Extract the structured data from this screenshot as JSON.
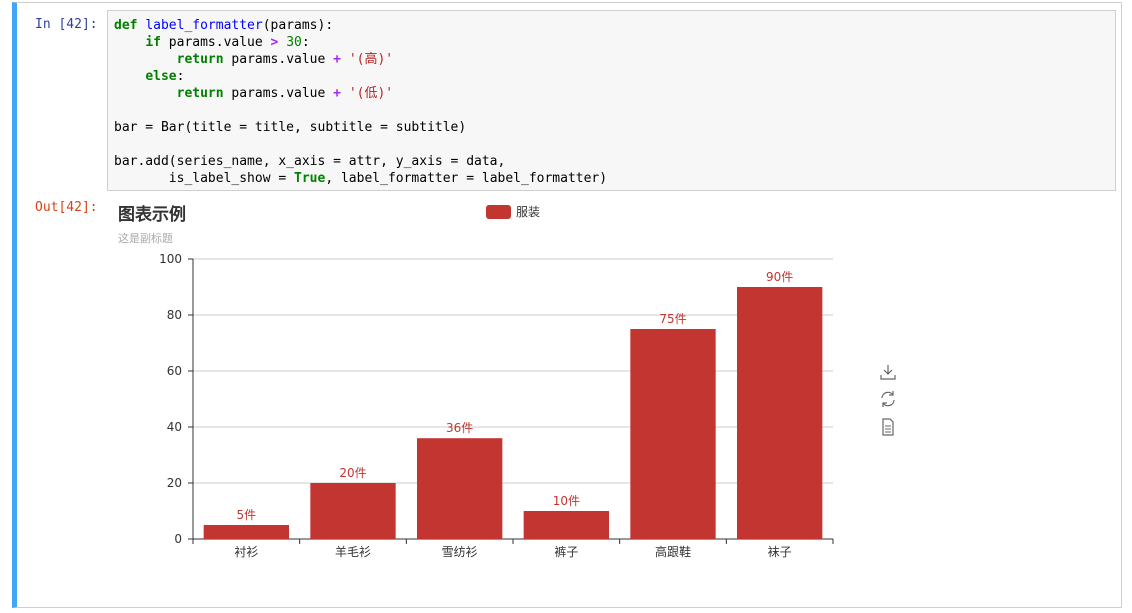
{
  "cell": {
    "in_prompt": "In [42]:",
    "out_prompt": "Out[42]:",
    "code_lines": [
      [
        [
          "kw",
          "def"
        ],
        [
          "t",
          " "
        ],
        [
          "fn",
          "label_formatter"
        ],
        [
          "t",
          "(params):"
        ]
      ],
      [
        [
          "t",
          "    "
        ],
        [
          "kw",
          "if"
        ],
        [
          "t",
          " params.value "
        ],
        [
          "op",
          ">"
        ],
        [
          "t",
          " "
        ],
        [
          "num",
          "30"
        ],
        [
          "t",
          ":"
        ]
      ],
      [
        [
          "t",
          "        "
        ],
        [
          "kw",
          "return"
        ],
        [
          "t",
          " params.value "
        ],
        [
          "op",
          "+"
        ],
        [
          "t",
          " "
        ],
        [
          "str",
          "'(高)'"
        ]
      ],
      [
        [
          "t",
          "    "
        ],
        [
          "kw",
          "else"
        ],
        [
          "t",
          ":"
        ]
      ],
      [
        [
          "t",
          "        "
        ],
        [
          "kw",
          "return"
        ],
        [
          "t",
          " params.value "
        ],
        [
          "op",
          "+"
        ],
        [
          "t",
          " "
        ],
        [
          "str",
          "'(低)'"
        ]
      ],
      [
        [
          "t",
          ""
        ]
      ],
      [
        [
          "t",
          "bar = Bar(title = title, subtitle = subtitle)"
        ]
      ],
      [
        [
          "t",
          ""
        ]
      ],
      [
        [
          "t",
          "bar.add(series_name, x_axis = attr, y_axis = data,"
        ]
      ],
      [
        [
          "t",
          "       is_label_show = "
        ],
        [
          "kw",
          "True"
        ],
        [
          "t",
          ", label_formatter = label_formatter)"
        ]
      ]
    ]
  },
  "chart_data": {
    "type": "bar",
    "title": "图表示例",
    "subtitle": "这是副标题",
    "categories": [
      "衬衫",
      "羊毛衫",
      "雪纺衫",
      "裤子",
      "高跟鞋",
      "袜子"
    ],
    "series": [
      {
        "name": "服装",
        "values": [
          5,
          20,
          36,
          10,
          75,
          90
        ],
        "color": "#c23531",
        "labels": [
          "5件",
          "20件",
          "36件",
          "10件",
          "75件",
          "90件"
        ]
      }
    ],
    "ylim": [
      0,
      100
    ],
    "yticks": [
      0,
      20,
      40,
      60,
      80,
      100
    ],
    "grid": true,
    "legend_position": "top-center"
  },
  "toolbox": {
    "icons": [
      "download-icon",
      "refresh-icon",
      "data-view-icon"
    ]
  }
}
